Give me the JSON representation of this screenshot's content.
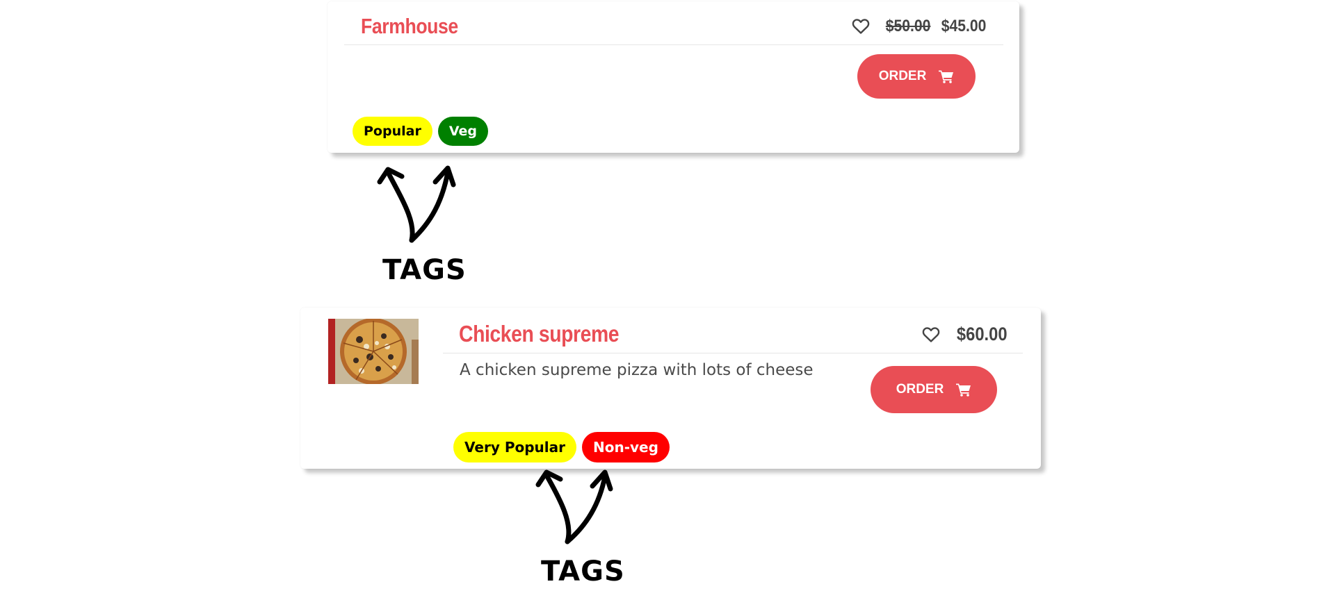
{
  "colors": {
    "accent": "#e94e55",
    "tag_yellow": "#ffff00",
    "tag_green": "#008000",
    "tag_red": "#ff0000"
  },
  "cards": [
    {
      "title": "Farmhouse",
      "price_old": "$50.00",
      "price_now": "$45.00",
      "order_label": "ORDER",
      "tags": [
        {
          "label": "Popular",
          "bg": "#ffff00",
          "fg": "#000000"
        },
        {
          "label": "Veg",
          "bg": "#008000",
          "fg": "#ffffff"
        }
      ]
    },
    {
      "title": "Chicken supreme",
      "price_now": "$60.00",
      "description": "A chicken supreme pizza with lots of cheese",
      "order_label": "ORDER",
      "tags": [
        {
          "label": "Very Popular",
          "bg": "#ffff00",
          "fg": "#000000"
        },
        {
          "label": "Non-veg",
          "bg": "#ff0000",
          "fg": "#ffffff"
        }
      ]
    }
  ],
  "annotations": [
    {
      "label": "TAGS"
    },
    {
      "label": "TAGS"
    }
  ]
}
